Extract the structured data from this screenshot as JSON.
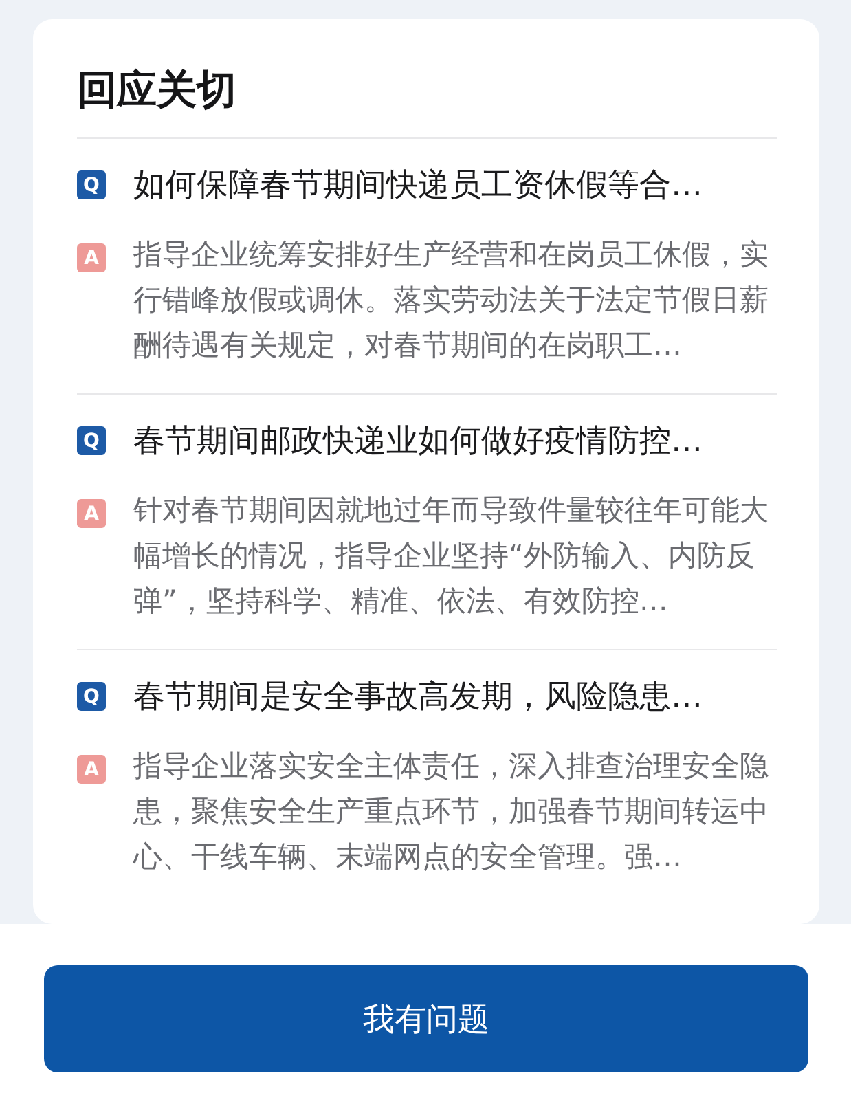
{
  "card": {
    "title": "回应关切"
  },
  "items": [
    {
      "q_badge": "Q",
      "question": "如何保障春节期间快递员工资休假等合…",
      "a_badge": "A",
      "answer": "指导企业统筹安排好生产经营和在岗员工休假，实行错峰放假或调休。落实劳动法关于法定节假日薪酬待遇有关规定，对春节期间的在岗职工…"
    },
    {
      "q_badge": "Q",
      "question": "春节期间邮政快递业如何做好疫情防控…",
      "a_badge": "A",
      "answer": "针对春节期间因就地过年而导致件量较往年可能大幅增长的情况，指导企业坚持“外防输入、内防反弹”，坚持科学、精准、依法、有效防控…"
    },
    {
      "q_badge": "Q",
      "question": "春节期间是安全事故高发期，风险隐患…",
      "a_badge": "A",
      "answer": "指导企业落实安全主体责任，深入排查治理安全隐患，聚焦安全生产重点环节，加强春节期间转运中心、干线车辆、末端网点的安全管理。强…"
    }
  ],
  "button": {
    "label": "我有问题"
  }
}
